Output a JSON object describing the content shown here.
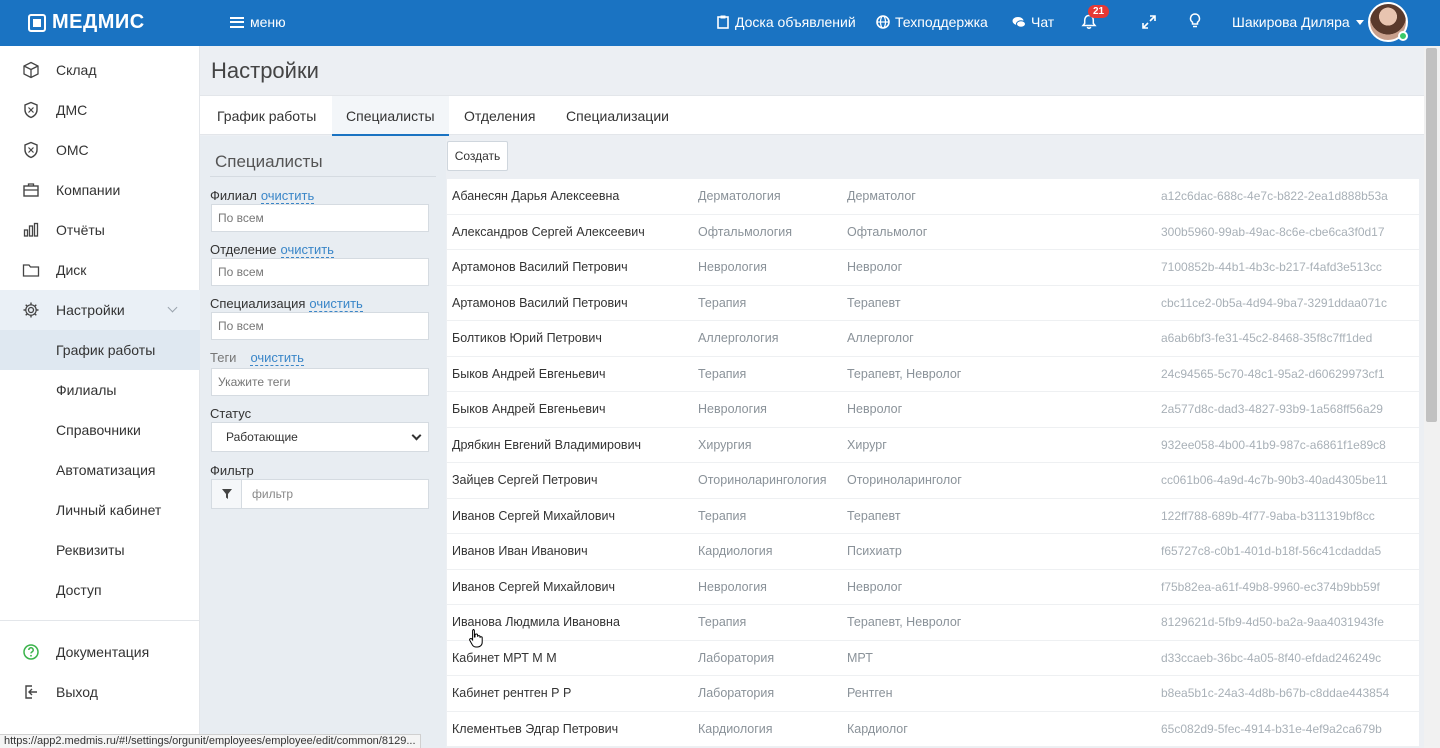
{
  "topbar": {
    "logo": "МЕДМИС",
    "menu_label": "меню",
    "board_label": "Доска объявлений",
    "support_label": "Техподдержка",
    "chat_label": "Чат",
    "notifications_count": "21",
    "user_name": "Шакирова Диляра",
    "colors": {
      "bar": "#1a73c2",
      "badge": "#e53935"
    }
  },
  "sidebar": {
    "items": [
      {
        "label": "Склад",
        "icon": "box-icon"
      },
      {
        "label": "ДМС",
        "icon": "shield-icon"
      },
      {
        "label": "ОМС",
        "icon": "shield-icon"
      },
      {
        "label": "Компании",
        "icon": "briefcase-icon"
      },
      {
        "label": "Отчёты",
        "icon": "chart-icon"
      },
      {
        "label": "Диск",
        "icon": "folder-icon"
      },
      {
        "label": "Настройки",
        "icon": "gear-icon"
      }
    ],
    "sub_items": [
      {
        "label": "График работы"
      },
      {
        "label": "Филиалы"
      },
      {
        "label": "Справочники"
      },
      {
        "label": "Автоматизация"
      },
      {
        "label": "Личный кабинет"
      },
      {
        "label": "Реквизиты"
      },
      {
        "label": "Доступ"
      }
    ],
    "bottom": [
      {
        "label": "Документация",
        "icon": "help-icon"
      },
      {
        "label": "Выход",
        "icon": "logout-icon"
      }
    ]
  },
  "page": {
    "title": "Настройки",
    "tabs": [
      "График работы",
      "Специалисты",
      "Отделения",
      "Специализации"
    ],
    "active_tab": "Специалисты"
  },
  "filters": {
    "title": "Специалисты",
    "branch_label": "Филиал",
    "department_label": "Отделение",
    "specialization_label": "Специализация",
    "tags_label": "Теги",
    "clear_label": "очистить",
    "branch_value": "По всем",
    "department_value": "По всем",
    "specialization_value": "По всем",
    "tags_placeholder": "Укажите теги",
    "status_label": "Статус",
    "status_value": "Работающие",
    "filter_label": "Фильтр",
    "filter_placeholder": "фильтр"
  },
  "actions": {
    "create_label": "Создать"
  },
  "table": {
    "rows": [
      {
        "name": "Абанесян Дарья Алексеевна",
        "department": "Дерматология",
        "specialization": "Дерматолог",
        "id": "a12c6dac-688c-4e7c-b822-2ea1d888b53a"
      },
      {
        "name": "Александров Сергей Алексеевич",
        "department": "Офтальмология",
        "specialization": "Офтальмолог",
        "id": "300b5960-99ab-49ac-8c6e-cbe6ca3f0d17"
      },
      {
        "name": "Артамонов Василий Петрович",
        "department": "Неврология",
        "specialization": "Невролог",
        "id": "7100852b-44b1-4b3c-b217-f4afd3e513cc"
      },
      {
        "name": "Артамонов Василий Петрович",
        "department": "Терапия",
        "specialization": "Терапевт",
        "id": "cbc11ce2-0b5a-4d94-9ba7-3291ddaa071c"
      },
      {
        "name": "Болтиков Юрий Петрович",
        "department": "Аллергология",
        "specialization": "Аллерголог",
        "id": "a6ab6bf3-fe31-45c2-8468-35f8c7ff1ded"
      },
      {
        "name": "Быков Андрей Евгеньевич",
        "department": "Терапия",
        "specialization": "Терапевт, Невролог",
        "id": "24c94565-5c70-48c1-95a2-d60629973cf1"
      },
      {
        "name": "Быков Андрей Евгеньевич",
        "department": "Неврология",
        "specialization": "Невролог",
        "id": "2a577d8c-dad3-4827-93b9-1a568ff56a29"
      },
      {
        "name": "Дрябкин Евгений Владимирович",
        "department": "Хирургия",
        "specialization": "Хирург",
        "id": "932ee058-4b00-41b9-987c-a6861f1e89c8"
      },
      {
        "name": "Зайцев Сергей Петрович",
        "department": "Оториноларингология",
        "specialization": "Оториноларинголог",
        "id": "cc061b06-4a9d-4c7b-90b3-40ad4305be11"
      },
      {
        "name": "Иванов Сергей Михайлович",
        "department": "Терапия",
        "specialization": "Терапевт",
        "id": "122ff788-689b-4f77-9aba-b311319bf8cc"
      },
      {
        "name": "Иванов Иван Иванович",
        "department": "Кардиология",
        "specialization": "Психиатр",
        "id": "f65727c8-c0b1-401d-b18f-56c41cdadda5"
      },
      {
        "name": "Иванов Сергей Михайлович",
        "department": "Неврология",
        "specialization": "Невролог",
        "id": "f75b82ea-a61f-49b8-9960-ec374b9bb59f"
      },
      {
        "name": "Иванова Людмила Ивановна",
        "department": "Терапия",
        "specialization": "Терапевт, Невролог",
        "id": "8129621d-5fb9-4d50-ba2a-9aa4031943fe"
      },
      {
        "name": "Кабинет МРТ М М",
        "department": "Лаборатория",
        "specialization": "МРТ",
        "id": "d33ccaeb-36bc-4a05-8f40-efdad246249c"
      },
      {
        "name": "Кабинет рентген Р Р",
        "department": "Лаборатория",
        "specialization": "Рентген",
        "id": "b8ea5b1c-24a3-4d8b-b67b-c8ddae443854"
      },
      {
        "name": "Клементьев Эдгар Петрович",
        "department": "Кардиология",
        "specialization": "Кардиолог",
        "id": "65c082d9-5fec-4914-b31e-4ef9a2ca679b"
      }
    ]
  },
  "statusbar": {
    "url": "https://app2.medmis.ru/#!/settings/orgunit/employees/employee/edit/common/8129..."
  }
}
